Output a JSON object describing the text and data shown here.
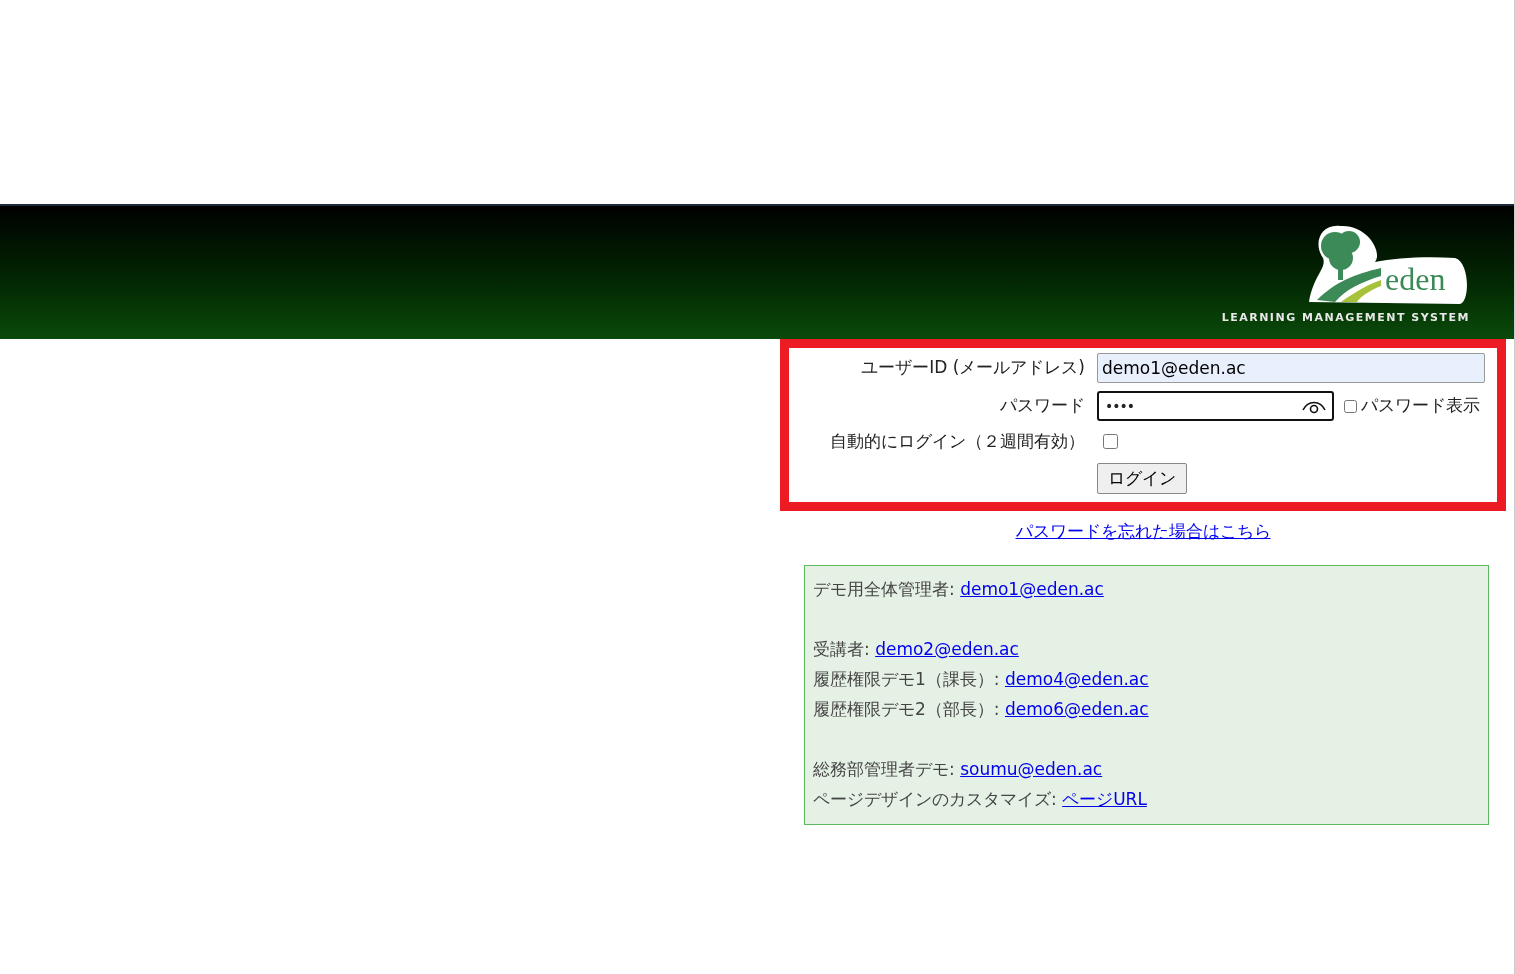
{
  "header": {
    "logo_text": "eden",
    "tagline": "LEARNING MANAGEMENT SYSTEM"
  },
  "login_form": {
    "user_id": {
      "label": "ユーザーID (メールアドレス)",
      "value": "demo1@eden.ac"
    },
    "password": {
      "label": "パスワード",
      "value": "••••",
      "show_label": "パスワード表示",
      "show_checked": false
    },
    "auto_login": {
      "label": "自動的にログイン（２週間有効）",
      "checked": false
    },
    "submit": "ログイン"
  },
  "forgot_link": "パスワードを忘れた場合はこちら",
  "demo_groups": [
    [
      {
        "label": "デモ用全体管理者: ",
        "link": "demo1@eden.ac"
      }
    ],
    [
      {
        "label": "受講者: ",
        "link": "demo2@eden.ac"
      },
      {
        "label": "履歴権限デモ1（課長）: ",
        "link": "demo4@eden.ac"
      },
      {
        "label": "履歴権限デモ2（部長）: ",
        "link": "demo6@eden.ac"
      }
    ],
    [
      {
        "label": "総務部管理者デモ: ",
        "link": "soumu@eden.ac"
      },
      {
        "label": "ページデザインのカスタマイズ: ",
        "link": "ページURL"
      }
    ]
  ]
}
